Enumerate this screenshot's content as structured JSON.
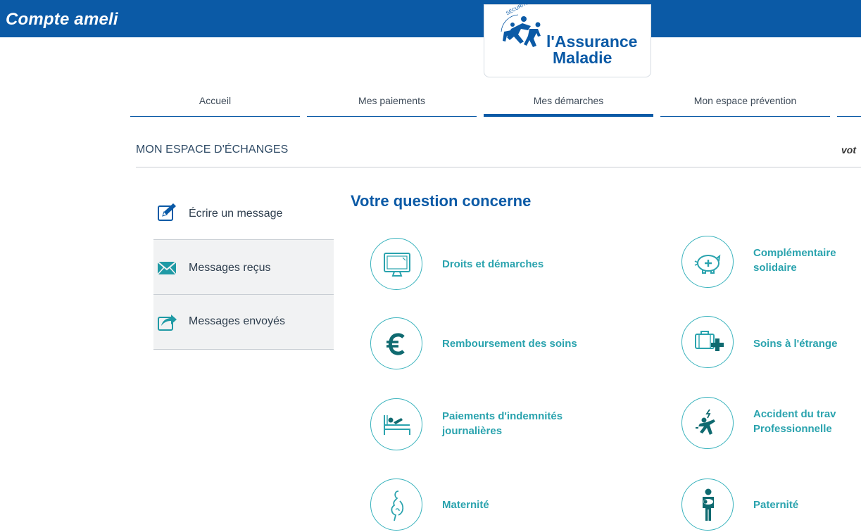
{
  "header": {
    "app_title": "Compte ameli",
    "logo_line1": "l'Assurance",
    "logo_line2": "Maladie",
    "logo_seal": "SÉCURITÉ SOCIALE"
  },
  "nav": {
    "tabs": [
      {
        "label": "Accueil",
        "active": false
      },
      {
        "label": "Mes paiements",
        "active": false
      },
      {
        "label": "Mes démarches",
        "active": true
      },
      {
        "label": "Mon espace prévention",
        "active": false
      }
    ]
  },
  "section": {
    "title": "MON ESPACE D'ÉCHANGES",
    "right_fragment": "vot"
  },
  "left_menu": {
    "items": [
      {
        "label": "Écrire un message",
        "icon": "edit-message-icon"
      },
      {
        "label": "Messages reçus",
        "icon": "envelope-icon"
      },
      {
        "label": "Messages envoyés",
        "icon": "sent-message-icon"
      }
    ]
  },
  "main": {
    "heading": "Votre question concerne",
    "topics": [
      {
        "line1": "Droits et démarches",
        "line2": "",
        "icon": "computer-monitor-icon"
      },
      {
        "line1": "Complémentaire",
        "line2": "solidaire",
        "icon": "piggy-bank-icon"
      },
      {
        "line1": "Remboursement des soins",
        "line2": "",
        "icon": "euro-icon"
      },
      {
        "line1": "Soins à l'étrange",
        "line2": "",
        "icon": "suitcase-medical-icon"
      },
      {
        "line1": "Paiements d'indemnités",
        "line2": "journalières",
        "icon": "bed-icon"
      },
      {
        "line1": "Accident du trav",
        "line2": "Professionnelle",
        "icon": "accident-icon"
      },
      {
        "line1": "Maternité",
        "line2": "",
        "icon": "pregnancy-icon"
      },
      {
        "line1": "Paternité",
        "line2": "",
        "icon": "father-baby-icon"
      }
    ]
  },
  "colors": {
    "brand_blue": "#0b5aa6",
    "teal": "#2aa3ae",
    "menu_text": "#2e3e4e"
  }
}
